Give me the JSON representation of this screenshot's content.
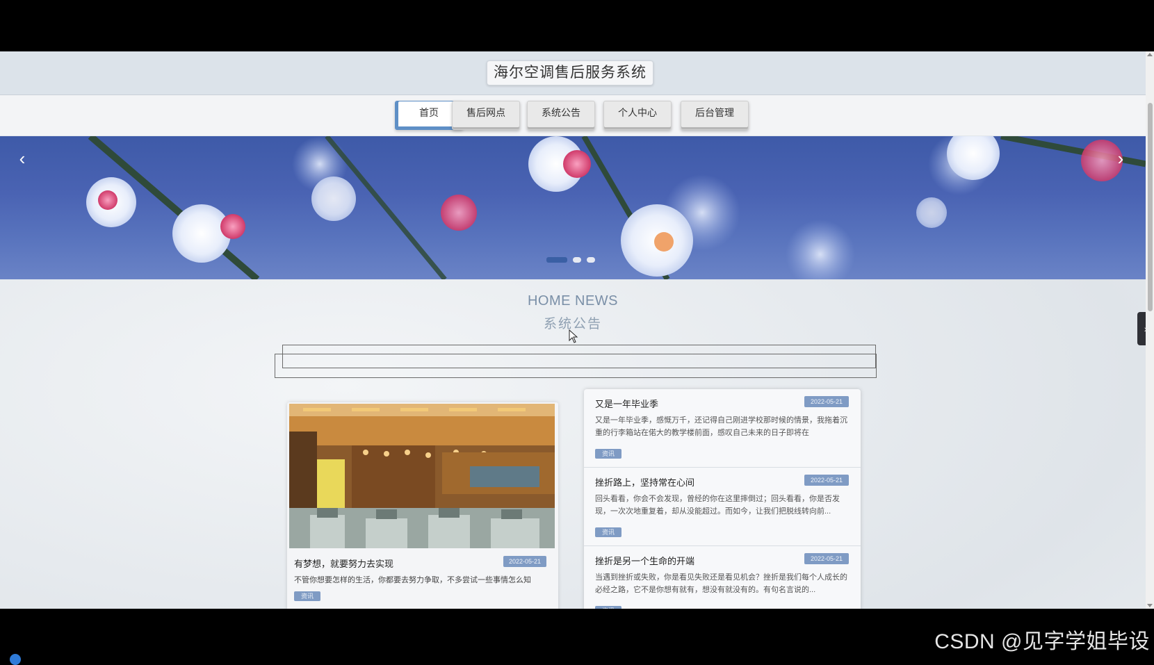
{
  "site": {
    "title": "海尔空调售后服务系统"
  },
  "nav": {
    "items": [
      {
        "label": "首页",
        "active": true
      },
      {
        "label": "售后网点",
        "active": false
      },
      {
        "label": "系统公告",
        "active": false
      },
      {
        "label": "个人中心",
        "active": false
      },
      {
        "label": "后台管理",
        "active": false
      }
    ]
  },
  "banner": {
    "prev_icon": "chevron-left-icon",
    "next_icon": "chevron-right-icon",
    "slide_count": 3,
    "active_slide": 1
  },
  "news": {
    "heading_en": "HOME NEWS",
    "heading_cn": "系统公告",
    "feature": {
      "title": "有梦想，就要努力去实现",
      "date": "2022-05-21",
      "excerpt": "不管你想要怎样的生活，你都要去努力争取，不多尝试一些事情怎么知",
      "tag": "资讯"
    },
    "list": [
      {
        "title": "又是一年毕业季",
        "date": "2022-05-21",
        "excerpt": "又是一年毕业季，感慨万千，还记得自己刚进学校那时候的情景，我拖着沉重的行李箱站在偌大的教学楼前面，感叹自己未来的日子即将在",
        "tag": "资讯"
      },
      {
        "title": "挫折路上，坚持常在心间",
        "date": "2022-05-21",
        "excerpt": "回头看看，你会不会发现，曾经的你在这里摔倒过；回头看看，你是否发现，一次次地重复着，却从没能超过。而如今，让我们把脱线转向前...",
        "tag": "资讯"
      },
      {
        "title": "挫折是另一个生命的开端",
        "date": "2022-05-21",
        "excerpt": "当遇到挫折或失败，你是看见失败还是看见机会？挫折是我们每个人成长的必经之路，它不是你想有就有，想没有就没有的。有句名言说的...",
        "tag": "资讯"
      }
    ]
  },
  "side_toggle_icon": "chevron-right-icon",
  "watermark": "CSDN @见字学姐毕设"
}
